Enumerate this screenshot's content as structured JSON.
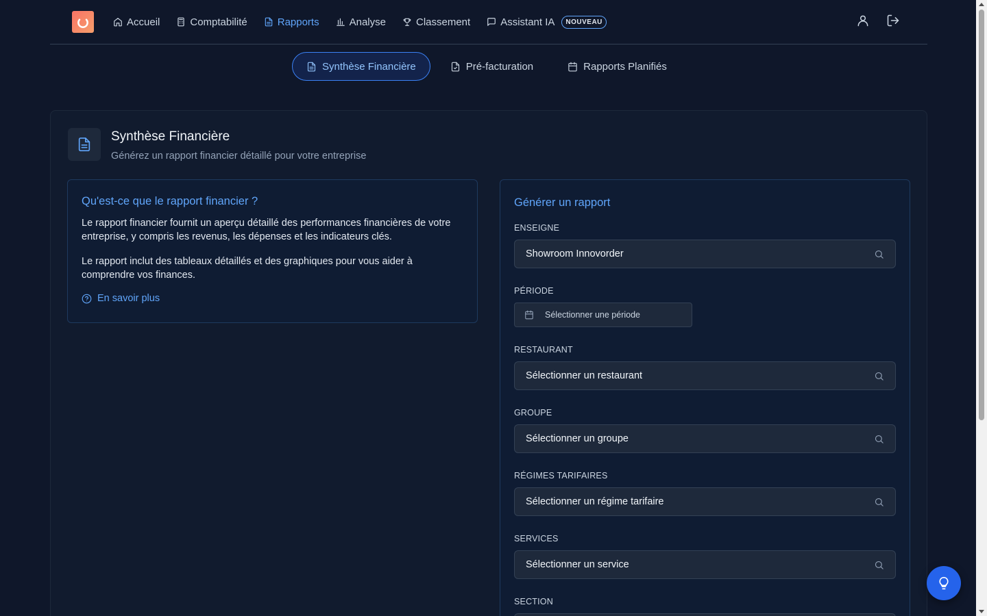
{
  "nav": {
    "items": [
      {
        "label": "Accueil",
        "icon": "home-icon"
      },
      {
        "label": "Comptabilité",
        "icon": "calculator-icon"
      },
      {
        "label": "Rapports",
        "icon": "file-text-icon",
        "active": true
      },
      {
        "label": "Analyse",
        "icon": "bar-chart-icon"
      },
      {
        "label": "Classement",
        "icon": "trophy-icon"
      },
      {
        "label": "Assistant IA",
        "icon": "message-icon"
      }
    ],
    "badge": "NOUVEAU"
  },
  "subtabs": [
    {
      "label": "Synthèse Financière",
      "active": true
    },
    {
      "label": "Pré-facturation"
    },
    {
      "label": "Rapports Planifiés"
    }
  ],
  "header": {
    "title": "Synthèse Financière",
    "subtitle": "Générez un rapport financier détaillé pour votre entreprise"
  },
  "info": {
    "title": "Qu'est-ce que le rapport financier ?",
    "p1": "Le rapport financier fournit un aperçu détaillé des performances financières de votre entreprise, y compris les revenus, les dépenses et les indicateurs clés.",
    "p2": "Le rapport inclut des tableaux détaillés et des graphiques pour vous aider à comprendre vos finances.",
    "more": "En savoir plus"
  },
  "form": {
    "title": "Générer un rapport",
    "enseigne": {
      "label": "ENSEIGNE",
      "value": "Showroom Innovorder"
    },
    "periode": {
      "label": "PÉRIODE",
      "placeholder": "Sélectionner une période"
    },
    "restaurant": {
      "label": "RESTAURANT",
      "placeholder": "Sélectionner un restaurant"
    },
    "groupe": {
      "label": "GROUPE",
      "placeholder": "Sélectionner un groupe"
    },
    "regimes": {
      "label": "RÉGIMES TARIFAIRES",
      "placeholder": "Sélectionner un régime tarifaire"
    },
    "services": {
      "label": "SERVICES",
      "placeholder": "Sélectionner un service"
    },
    "section": {
      "label": "SECTION"
    }
  },
  "colors": {
    "accent": "#60a5fa",
    "background": "#0f172a",
    "fab": "#2563eb"
  }
}
